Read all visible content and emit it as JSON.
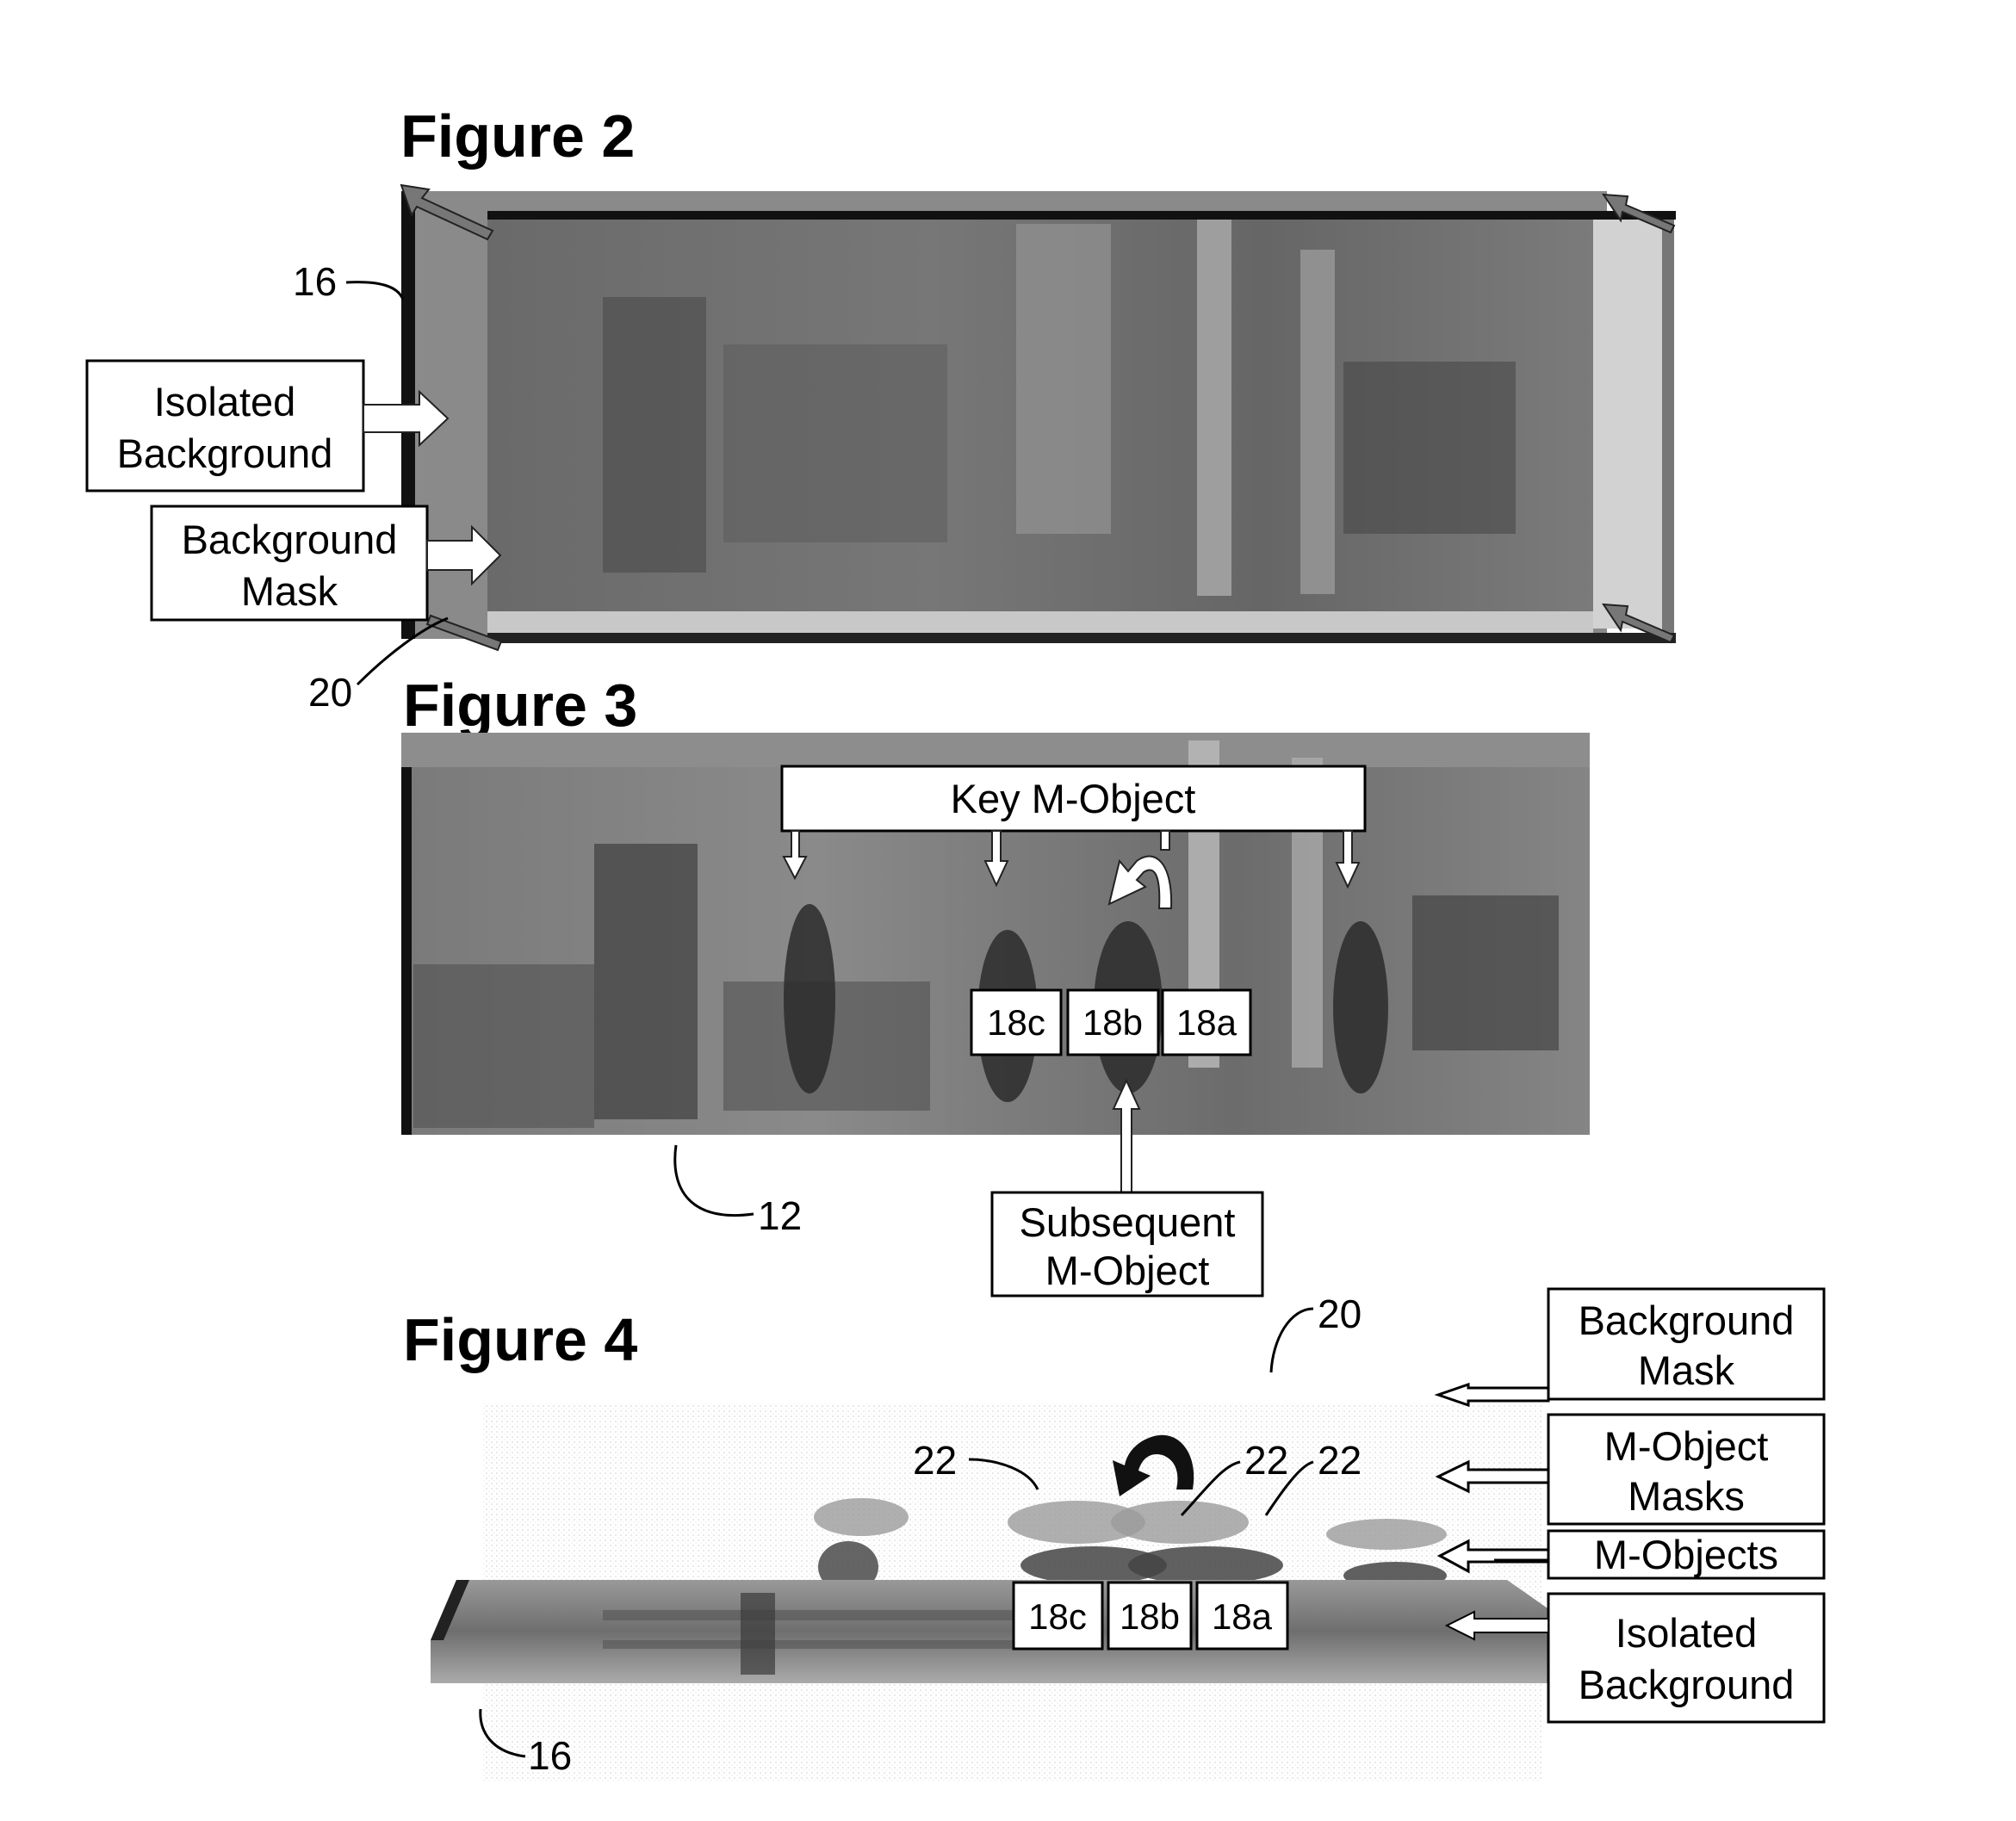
{
  "figures": [
    {
      "title": "Figure 2",
      "labels": {
        "isolated_background": [
          "Isolated",
          "Background"
        ],
        "background_mask": [
          "Background",
          "Mask"
        ]
      },
      "refs": {
        "isolated_background_ref": "16",
        "background_mask_ref": "20"
      }
    },
    {
      "title": "Figure 3",
      "labels": {
        "key_m_object": "Key M-Object",
        "subsequent_m_object": [
          "Subsequent",
          "M-Object"
        ],
        "object_tags": [
          "18c",
          "18b",
          "18a"
        ]
      },
      "refs": {
        "frame_ref": "12"
      }
    },
    {
      "title": "Figure 4",
      "labels": {
        "background_mask": [
          "Background",
          "Mask"
        ],
        "m_object_masks": [
          "M-Object",
          "Masks"
        ],
        "m_objects": "M-Objects",
        "isolated_background": [
          "Isolated",
          "Background"
        ],
        "object_tags": [
          "18c",
          "18b",
          "18a"
        ]
      },
      "refs": {
        "background_mask_ref": "20",
        "mask_refs": [
          "22",
          "22",
          "22"
        ],
        "isolated_background_ref": "16"
      }
    }
  ],
  "icons": {
    "curved_arrow": "rotate-arrow-icon",
    "block_arrow": "arrow-icon"
  }
}
